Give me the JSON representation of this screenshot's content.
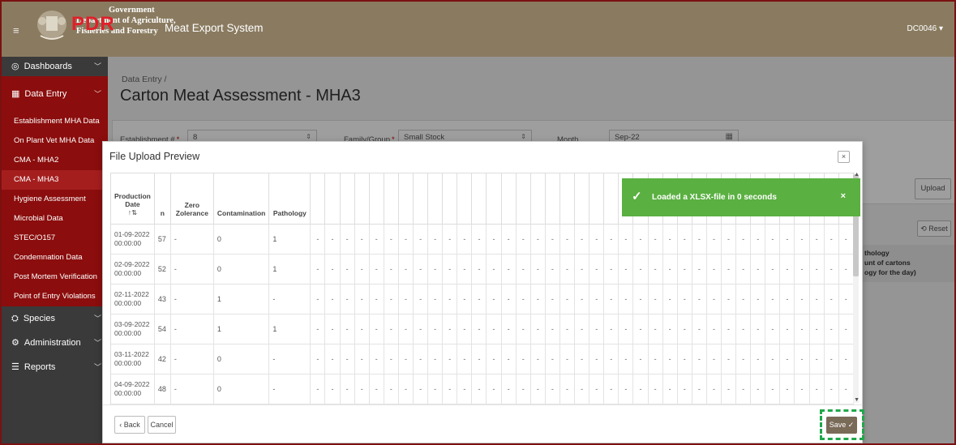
{
  "header": {
    "gov_line1": "Government",
    "gov_line2": "Department of Agriculture,",
    "gov_line3": "Fisheries and Forestry",
    "pdr": "PDR",
    "app_title": "Meat Export System",
    "user": "DC0046 ▾"
  },
  "sidebar": {
    "items": [
      {
        "label": "Dashboards",
        "icon": "dashboard-icon",
        "glyph": "◎"
      },
      {
        "label": "Data Entry",
        "icon": "table-icon",
        "glyph": "▦"
      }
    ],
    "sub_items": [
      "Establishment MHA Data",
      "On Plant Vet MHA Data",
      "CMA - MHA2",
      "CMA - MHA3",
      "Hygiene Assessment",
      "Microbial Data",
      "STEC/O157",
      "Condemnation Data",
      "Post Mortem Verification",
      "Point of Entry Violations"
    ],
    "bottom_items": [
      {
        "label": "Species",
        "glyph": "⛭"
      },
      {
        "label": "Administration",
        "glyph": "⚙"
      },
      {
        "label": "Reports",
        "glyph": "☰"
      }
    ]
  },
  "page": {
    "breadcrumb": "Data Entry /",
    "title": "Carton Meat Assessment - MHA3",
    "filters": {
      "establishment_label": "Establishment #",
      "establishment_value": "8",
      "family_label": "Family/Group",
      "family_value": "Small Stock",
      "month_label": "Month",
      "month_value": "Sep-22"
    },
    "upload_label": "Upload",
    "reset_label": "Reset",
    "pathology_line1": "thology",
    "pathology_line2": "unt of cartons",
    "pathology_line3": "ogy for the day)",
    "pager": "|< < > >|"
  },
  "modal": {
    "title": "File Upload Preview",
    "close": "×",
    "columns": {
      "date_l1": "Production",
      "date_l2": "Date",
      "sort_icon": "↑⇅",
      "n": "n",
      "zero_l1": "Zero",
      "zero_l2": "Zolerance",
      "contamination": "Contamination",
      "pathology": "Pathology"
    },
    "rows": [
      {
        "date": "01-09-2022",
        "time": "00:00:00",
        "n": "57",
        "zero": "-",
        "contamination": "0",
        "pathology": "1"
      },
      {
        "date": "02-09-2022",
        "time": "00:00:00",
        "n": "52",
        "zero": "-",
        "contamination": "0",
        "pathology": "1"
      },
      {
        "date": "02-11-2022",
        "time": "00:00:00",
        "n": "43",
        "zero": "-",
        "contamination": "1",
        "pathology": "-"
      },
      {
        "date": "03-09-2022",
        "time": "00:00:00",
        "n": "54",
        "zero": "-",
        "contamination": "1",
        "pathology": "1"
      },
      {
        "date": "03-11-2022",
        "time": "00:00:00",
        "n": "42",
        "zero": "-",
        "contamination": "0",
        "pathology": "-"
      },
      {
        "date": "04-09-2022",
        "time": "00:00:00",
        "n": "48",
        "zero": "-",
        "contamination": "0",
        "pathology": "-"
      }
    ],
    "back_label": "Back",
    "cancel_label": "Cancel",
    "save_label": "Save ✓"
  },
  "toast": {
    "message": "Loaded a XLSX-file in 0 seconds",
    "close": "×"
  },
  "colors": {
    "header": "#8a7b60",
    "sidebar": "#3a3a3a",
    "sidebar_active": "#8b0d0d",
    "toast": "#5ab041",
    "save_button": "#7a6a58",
    "highlight_dash": "#1fa74a"
  }
}
